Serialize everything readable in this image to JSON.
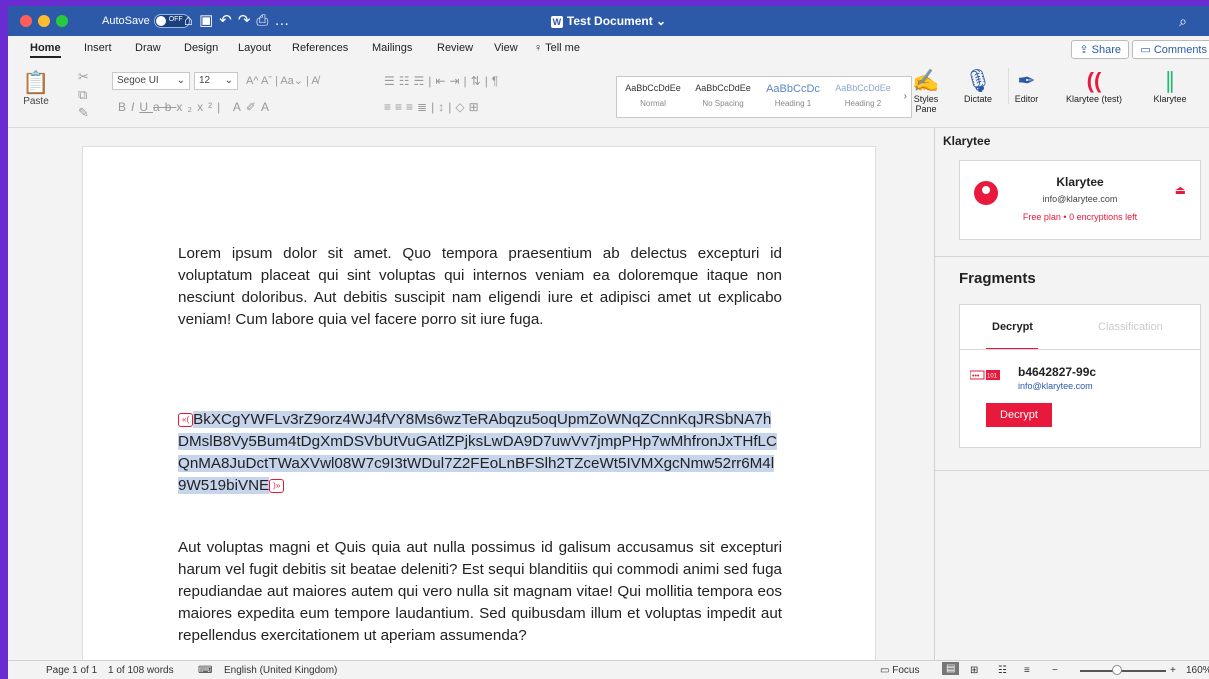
{
  "titlebar": {
    "autosave_label": "AutoSave",
    "autosave_state": "OFF",
    "doc_title": "Test Document",
    "traffic_colors": [
      "#ff5f57",
      "#febc2e",
      "#28c840"
    ]
  },
  "menu": {
    "tabs": [
      "Home",
      "Insert",
      "Draw",
      "Design",
      "Layout",
      "References",
      "Mailings",
      "Review",
      "View",
      "Tell me"
    ],
    "share": "Share",
    "comments": "Comments"
  },
  "ribbon": {
    "paste": "Paste",
    "font_name": "Segoe UI",
    "font_size": "12",
    "styles": [
      {
        "sample": "AaBbCcDdEe",
        "name": "Normal"
      },
      {
        "sample": "AaBbCcDdEe",
        "name": "No Spacing"
      },
      {
        "sample": "AaBbCcDc",
        "name": "Heading 1"
      },
      {
        "sample": "AaBbCcDdEe",
        "name": "Heading 2"
      }
    ],
    "styles_pane": "Styles Pane",
    "dictate": "Dictate",
    "editor": "Editor",
    "klarytee_test": "Klarytee (test)",
    "klarytee": "Klarytee"
  },
  "document": {
    "para1": "Lorem ipsum dolor sit amet. Quo tempora praesentium ab delectus excepturi id voluptatum placeat qui sint voluptas qui internos veniam ea doloremque itaque non nesciunt doloribus. Aut debitis suscipit nam eligendi iure et adipisci amet ut explicabo veniam! Cum labore quia vel facere porro sit iure fuga.",
    "encrypted": "BkXCgYWFLv3rZ9orz4WJ4fVY8Ms6wzTeRAbqzu5oqUpmZoWNqZCnnKqJRSbNA7hDMslB8Vy5Bum4tDgXmDSVbUtVuGAtlZPjksLwDA9D7uwVv7jmpPHp7wMhfronJxTHfLCQnMA8JuDctTWaXVwl08W7c9I3tWDul7Z2FEoLnBFSlh2TZceWt5IVMXgcNmw52rr6M4l9W519biVNE",
    "para2": "Aut voluptas magni et Quis quia aut nulla possimus id galisum accusamus sit excepturi harum vel fugit debitis sit beatae deleniti? Est sequi blanditiis qui commodi animi sed fuga repudiandae aut maiores autem qui vero nulla sit magnam vitae! Qui mollitia tempora eos maiores expedita eum tempore laudantium. Sed quibusdam illum et voluptas impedit aut repellendus exercitationem ut aperiam assumenda?"
  },
  "sidebar": {
    "title": "Klarytee",
    "user_name": "Klarytee",
    "user_email": "info@klarytee.com",
    "plan": "Free plan • 0 encryptions left",
    "fragments_title": "Fragments",
    "tab_decrypt": "Decrypt",
    "tab_classification": "Classification",
    "fragment_id": "b4642827-99c",
    "fragment_email": "info@klarytee.com",
    "decrypt_button": "Decrypt",
    "accent": "#e8193c"
  },
  "status": {
    "page": "Page 1 of 1",
    "words": "1 of 108 words",
    "language": "English (United Kingdom)",
    "focus": "Focus",
    "zoom": "160%"
  }
}
